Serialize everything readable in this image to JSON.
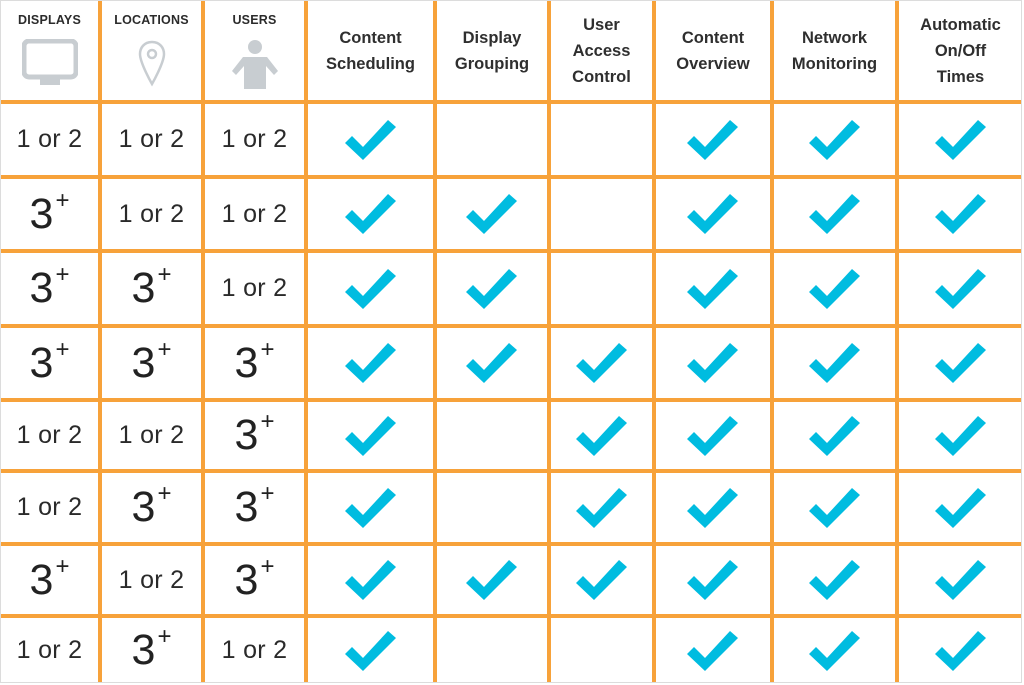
{
  "colors": {
    "grid": "#F7A23A",
    "check": "#00BCE0",
    "icon": "#C8CDD1",
    "text": "#2a2a2a"
  },
  "header": {
    "count_columns": [
      {
        "label": "DISPLAYS",
        "icon": "monitor-icon"
      },
      {
        "label": "LOCATIONS",
        "icon": "map-pin-icon"
      },
      {
        "label": "USERS",
        "icon": "user-icon"
      }
    ],
    "feature_columns": [
      {
        "lines": [
          "Content",
          "Scheduling"
        ]
      },
      {
        "lines": [
          "Display",
          "Grouping"
        ]
      },
      {
        "lines": [
          "User",
          "Access",
          "Control"
        ]
      },
      {
        "lines": [
          "Content",
          "Overview"
        ]
      },
      {
        "lines": [
          "Network",
          "Monitoring"
        ]
      },
      {
        "lines": [
          "Automatic",
          "On/Off",
          "Times"
        ]
      }
    ]
  },
  "rows": [
    {
      "displays": "1 or 2",
      "locations": "1 or 2",
      "users": "1 or 2",
      "features": [
        true,
        false,
        false,
        true,
        true,
        true
      ]
    },
    {
      "displays": "3+",
      "locations": "1 or 2",
      "users": "1 or 2",
      "features": [
        true,
        true,
        false,
        true,
        true,
        true
      ]
    },
    {
      "displays": "3+",
      "locations": "3+",
      "users": "1 or 2",
      "features": [
        true,
        true,
        false,
        true,
        true,
        true
      ]
    },
    {
      "displays": "3+",
      "locations": "3+",
      "users": "3+",
      "features": [
        true,
        true,
        true,
        true,
        true,
        true
      ]
    },
    {
      "displays": "1 or 2",
      "locations": "1 or 2",
      "users": "3+",
      "features": [
        true,
        false,
        true,
        true,
        true,
        true
      ]
    },
    {
      "displays": "1 or 2",
      "locations": "3+",
      "users": "3+",
      "features": [
        true,
        false,
        true,
        true,
        true,
        true
      ]
    },
    {
      "displays": "3+",
      "locations": "1 or 2",
      "users": "3+",
      "features": [
        true,
        true,
        true,
        true,
        true,
        true
      ]
    },
    {
      "displays": "1 or 2",
      "locations": "3+",
      "users": "1 or 2",
      "features": [
        true,
        false,
        false,
        true,
        true,
        true
      ]
    }
  ]
}
